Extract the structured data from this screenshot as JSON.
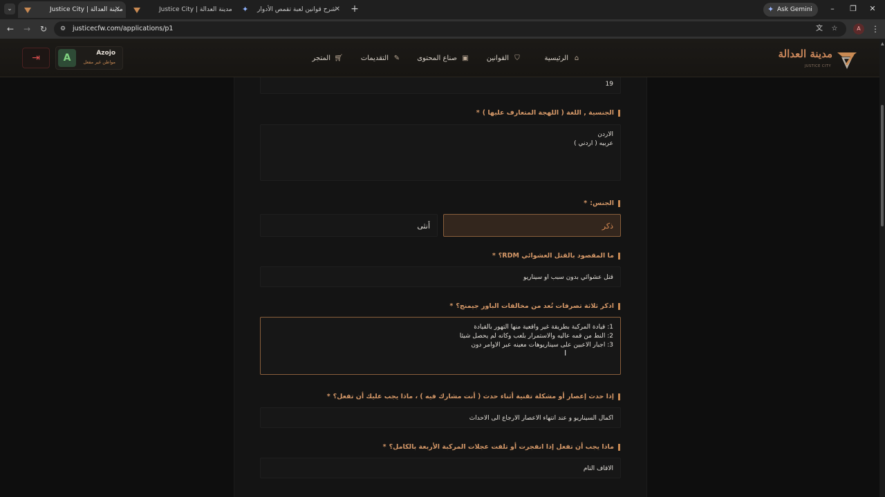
{
  "browser": {
    "tabs": [
      {
        "title": "Justice City | مدينة العدالة",
        "active": true
      },
      {
        "title": "Justice City | مدينة العدالة",
        "active": false
      },
      {
        "title": "شرح قوانين لعبة تقمص الأدوار",
        "active": false
      }
    ],
    "ask_gemini": "Ask Gemini",
    "url": "justicecfw.com/applications/p1",
    "profile_initial": "A"
  },
  "site": {
    "brand_name": "مدينة العدالة",
    "brand_sub": "JUSTICE CITY",
    "nav": [
      {
        "label": "الرئيسية",
        "icon": "home-icon"
      },
      {
        "label": "القوانين",
        "icon": "shield-icon"
      },
      {
        "label": "صناع المحتوى",
        "icon": "video-icon"
      },
      {
        "label": "التقديمات",
        "icon": "edit-icon"
      },
      {
        "label": "المتجر",
        "icon": "cart-icon"
      }
    ],
    "user": {
      "name": "Azojo",
      "status": "مواطن غير مفعل",
      "avatar_letter": "A"
    },
    "accent": "#c98a53"
  },
  "form": {
    "age_value": "19",
    "nationality": {
      "label": "الجنسية , اللغة ( اللهجة المتعارف عليها )",
      "lines": [
        "الاردن",
        "عربيه ( اردني )"
      ]
    },
    "gender": {
      "label": "الجنس:",
      "options": [
        {
          "label": "ذكر",
          "selected": true
        },
        {
          "label": "أنثى",
          "selected": false
        }
      ]
    },
    "rdm": {
      "label": "ما المقصود بالقتل العشوائي RDM؟",
      "answer": "قتل عشوائي بدون سبب او سيناريو"
    },
    "powergaming": {
      "label": "اذكر ثلاثة تصرفات تُعد من مخالفات الباور جيمنج؟",
      "lines": [
        "1: قيادة المركبة بطريقة غير واقعية منها التهور بالقيادة",
        "2: النط من قمه عاليه والاستمرار بلعب وكانه لم يحصل شيئا",
        "3: اجبار الاعبين على سيناريوهات معينه عبر الاوامر دون"
      ]
    },
    "crash": {
      "label": "إذا حدث إعصار أو مشكلة تقنية أثناء حدث ( أنت مشارك فيه ) ، ماذا يجب عليك أن تفعل؟",
      "answer": "اكمال السيناريو و عند انتهاء الاعصار الارجاع الى الاحداث"
    },
    "tires": {
      "label": "ماذا يجب أن تفعل إذا انفجرت أو تلفت عجلات المركبة الأربعة بالكامل؟",
      "answer": "الاقاف التام"
    },
    "required_mark": "*"
  }
}
